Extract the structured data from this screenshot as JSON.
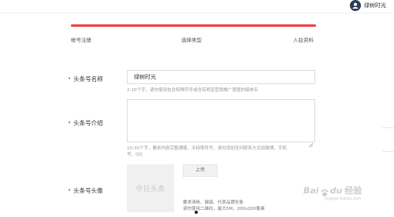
{
  "header": {
    "username": "绿树时光"
  },
  "progress": {
    "fraction": 1.0,
    "color": "#f04142"
  },
  "steps": [
    {
      "label": "帐号注册"
    },
    {
      "label": "选择类型"
    },
    {
      "label": "入驻资料"
    }
  ],
  "form": {
    "name": {
      "label": "头条号名称",
      "value": "绿树时光",
      "hint": "2-10个字，请勿使用包含特殊符号或含有明显营销推广意图的媒体名"
    },
    "intro": {
      "label": "头条号介绍",
      "value": "",
      "hint_line1": "10-30个字，要求内容完整通顺，无特殊符号，请勿添加任何联系方式如微博、手机",
      "hint_line2": "号、QQ"
    },
    "avatar": {
      "label": "头条号头像",
      "preview_text": "今日头条",
      "upload_label": "上传",
      "req_line1": "要求清晰、健康、代表品牌形象",
      "req_line2": "请勿使用二维码，最大5M，200x200像素"
    }
  },
  "watermark": {
    "bai": "Bai",
    "du": "du",
    "jingyan": "经验",
    "url": "jingyan.baidu.com"
  },
  "colors": {
    "required": "#f04142",
    "accent": "#f04142"
  }
}
